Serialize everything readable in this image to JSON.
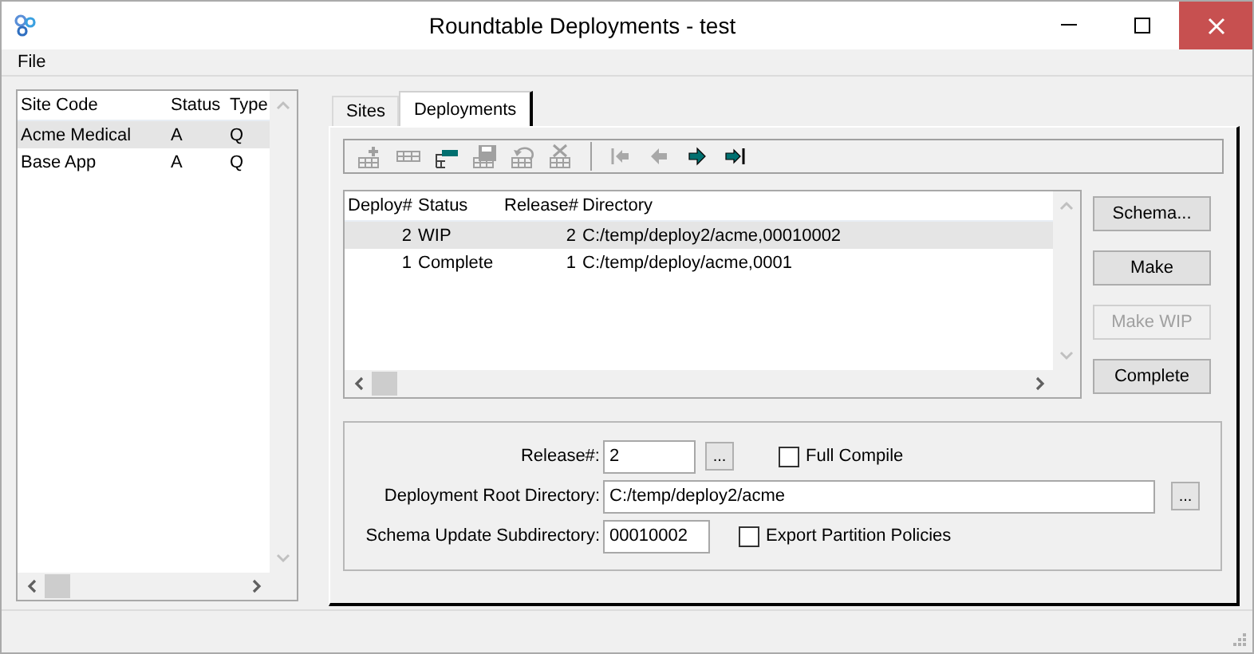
{
  "window": {
    "title": "Roundtable Deployments - test"
  },
  "menu": [
    {
      "label": "File"
    }
  ],
  "sites": {
    "columns": [
      "Site Code",
      "Status",
      "Type"
    ],
    "rows": [
      {
        "cells": [
          "Acme Medical",
          "A",
          "Q"
        ],
        "selected": true
      },
      {
        "cells": [
          "Base App",
          "A",
          "Q"
        ],
        "selected": false
      }
    ]
  },
  "tabs": [
    {
      "label": "Sites",
      "selected": false
    },
    {
      "label": "Deployments",
      "selected": true
    }
  ],
  "toolbar": [
    {
      "kind": "add",
      "disabled": true
    },
    {
      "kind": "table",
      "disabled": true
    },
    {
      "kind": "edit",
      "disabled": false
    },
    {
      "kind": "save",
      "disabled": true
    },
    {
      "kind": "undo",
      "disabled": true
    },
    {
      "kind": "delete",
      "disabled": true
    },
    {
      "kind": "first",
      "disabled": true
    },
    {
      "kind": "previous",
      "disabled": true
    },
    {
      "kind": "next",
      "disabled": false
    },
    {
      "kind": "last",
      "disabled": false
    }
  ],
  "deployments": {
    "columns": [
      "Deploy#",
      "Status",
      "Release#",
      "Directory"
    ],
    "rows": [
      {
        "cells": [
          "2",
          "WIP",
          "2",
          "C:/temp/deploy2/acme,00010002"
        ],
        "selected": true
      },
      {
        "cells": [
          "1",
          "Complete",
          "1",
          "C:/temp/deploy/acme,0001"
        ],
        "selected": false
      }
    ]
  },
  "buttons": [
    {
      "label": "Schema...",
      "disabled": false
    },
    {
      "label": "Make",
      "disabled": false
    },
    {
      "label": "Make WIP",
      "disabled": true
    },
    {
      "label": "Complete",
      "disabled": false
    }
  ],
  "form": {
    "release_label": "Release#:",
    "release_value": "2",
    "release_browse": "...",
    "full_compile": {
      "label": "Full Compile",
      "checked": false
    },
    "root_label": "Deployment Root Directory:",
    "root_value": "C:/temp/deploy2/acme",
    "root_browse": "...",
    "subdir_label": "Schema Update Subdirectory:",
    "subdir_value": "00010002",
    "export_policies": {
      "label": "Export Partition Policies",
      "checked": false
    }
  }
}
